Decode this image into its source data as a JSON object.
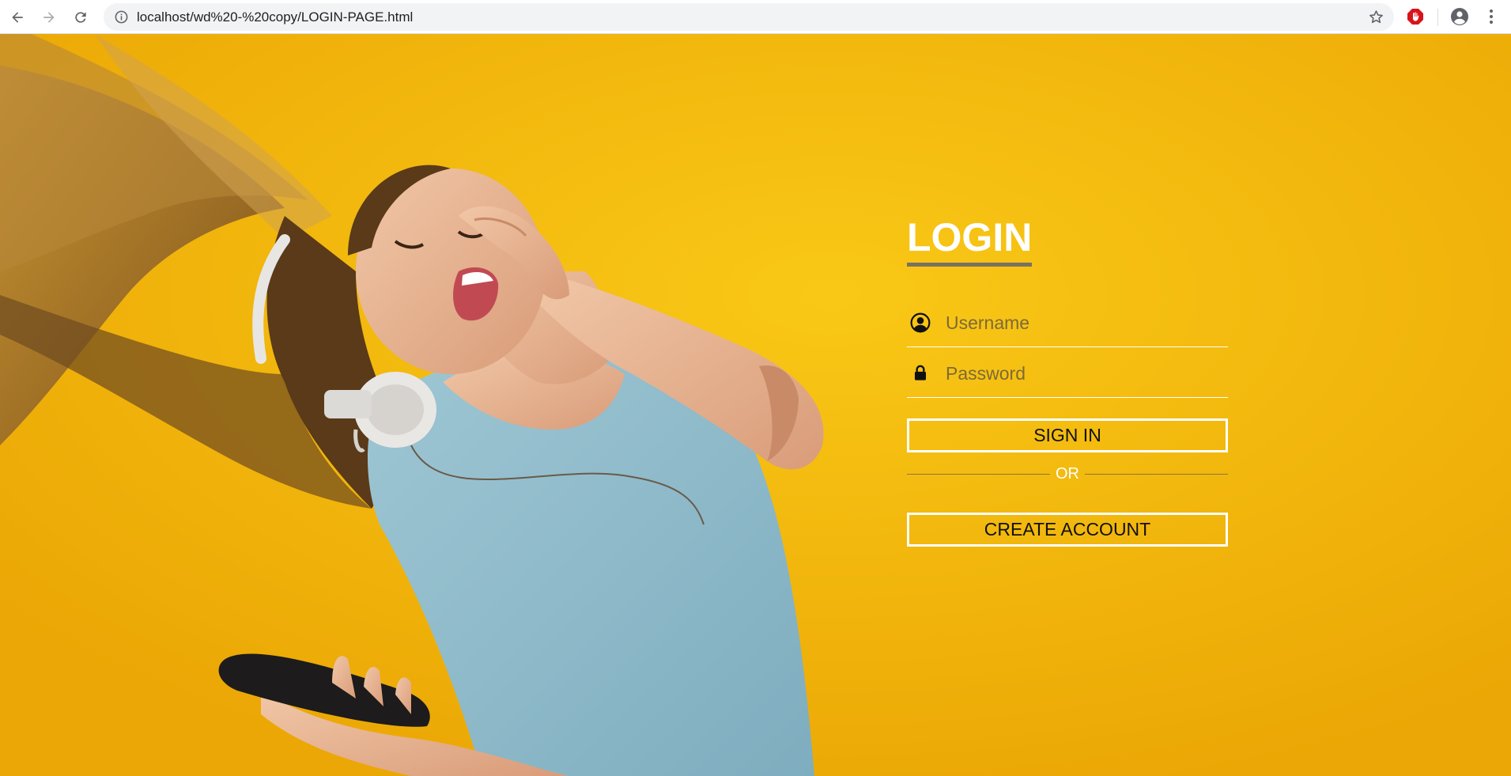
{
  "browser": {
    "url": "localhost/wd%20-%20copy/LOGIN-PAGE.html",
    "icons": {
      "back": "arrow-left-icon",
      "forward": "arrow-right-icon",
      "reload": "reload-icon",
      "site_info": "info-circle-icon",
      "bookmark": "star-icon",
      "extension": "adblock-stop-icon",
      "profile": "account-circle-icon",
      "menu": "kebab-menu-icon"
    }
  },
  "login": {
    "title": "LOGIN",
    "username_placeholder": "Username",
    "password_placeholder": "Password",
    "signin_label": "SIGN IN",
    "or_label": "OR",
    "create_label": "CREATE ACCOUNT"
  },
  "colors": {
    "background": "#f4b30a",
    "title_underline": "#7a7162",
    "button_border": "#ffffff",
    "text_white": "#ffffff"
  }
}
